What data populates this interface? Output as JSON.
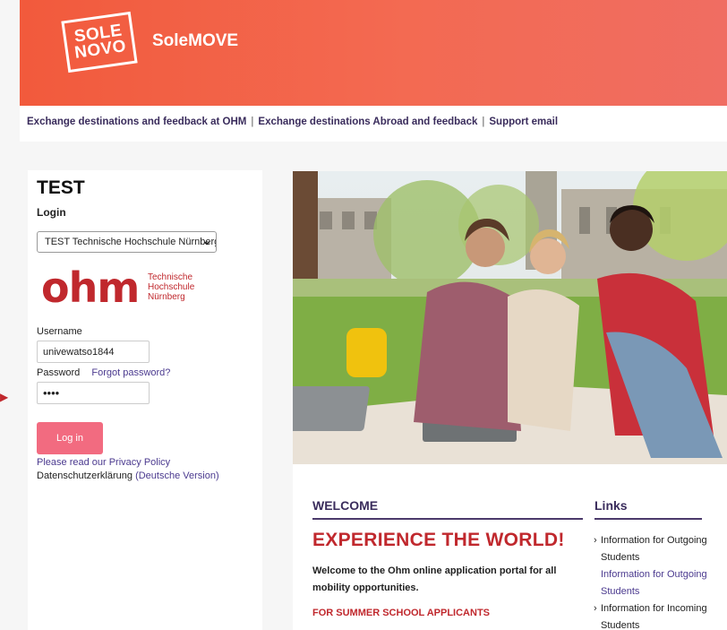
{
  "header": {
    "logo_line1": "SOLE",
    "logo_line2": "NOVO",
    "app_title": "SoleMOVE"
  },
  "topnav": {
    "links": [
      "Exchange destinations and feedback at OHM",
      "Exchange destinations Abroad and feedback",
      "Support email"
    ],
    "separator": "|"
  },
  "login": {
    "title": "TEST",
    "login_label": "Login",
    "institution_selected": "TEST Technische Hochschule Nürnberg",
    "ohm_logo_word": "ohm",
    "ohm_logo_sub": [
      "Technische",
      "Hochschule",
      "Nürnberg"
    ],
    "username_label": "Username",
    "username_value": "univewatso1844",
    "password_label": "Password",
    "forgot_password": "Forgot password?",
    "password_mask": "••••",
    "login_button": "Log in",
    "privacy_link": "Please read our Privacy Policy",
    "datenschutz_text": "Datenschutzerklärung ",
    "datenschutz_link": "(Deutsche Version)"
  },
  "welcome": {
    "heading": "WELCOME",
    "tagline": "EXPERIENCE THE WORLD!",
    "intro": "Welcome to the Ohm online application portal for all mobility opportunities.",
    "summer": "FOR SUMMER SCHOOL APPLICANTS"
  },
  "links_section": {
    "heading": "Links",
    "items": [
      {
        "bullet": "›",
        "text": "Information for Outgoing Students"
      },
      {
        "link": "Information for Outgoing Students"
      },
      {
        "bullet": "›",
        "text": "Information for Incoming Students"
      }
    ]
  },
  "colors": {
    "header_gradient_start": "#f25a3c",
    "header_gradient_end": "#f06d62",
    "accent_red": "#c0282d",
    "link_purple": "#4b3a8f",
    "button_pink": "#f26b80"
  }
}
